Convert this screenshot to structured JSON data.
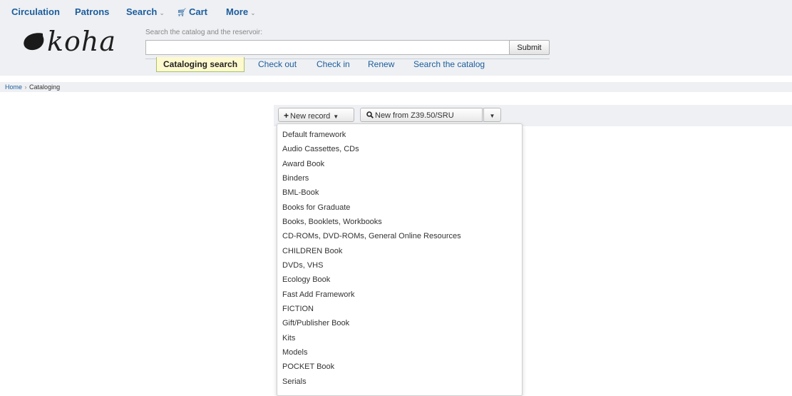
{
  "topnav": {
    "circulation": "Circulation",
    "patrons": "Patrons",
    "search": "Search",
    "cart": "Cart",
    "more": "More"
  },
  "logo": {
    "text": "koha"
  },
  "search": {
    "label": "Search the catalog and the reservoir:",
    "value": "",
    "placeholder": "",
    "submit": "Submit"
  },
  "tabs": {
    "active": "Cataloging search",
    "items": [
      "Check out",
      "Check in",
      "Renew",
      "Search the catalog"
    ]
  },
  "breadcrumb": {
    "home": "Home",
    "separator": "›",
    "current": "Cataloging"
  },
  "toolbar": {
    "new_record": "New record",
    "new_from_z": "New from Z39.50/SRU"
  },
  "frameworks": [
    "Default framework",
    "Audio Cassettes, CDs",
    "Award Book",
    "Binders",
    "BML-Book",
    "Books for Graduate",
    "Books, Booklets, Workbooks",
    "CD-ROMs, DVD-ROMs, General Online Resources",
    "CHILDREN Book",
    "DVDs, VHS",
    "Ecology Book",
    "Fast Add Framework",
    "FICTION",
    "Gift/Publisher Book",
    "Kits",
    "Models",
    "POCKET Book",
    "Serials"
  ],
  "colors": {
    "link": "#1c5d9c",
    "nav_bg": "#eef0f3",
    "active_tab_bg": "#fff9cf",
    "active_tab_border": "#a6c468"
  }
}
